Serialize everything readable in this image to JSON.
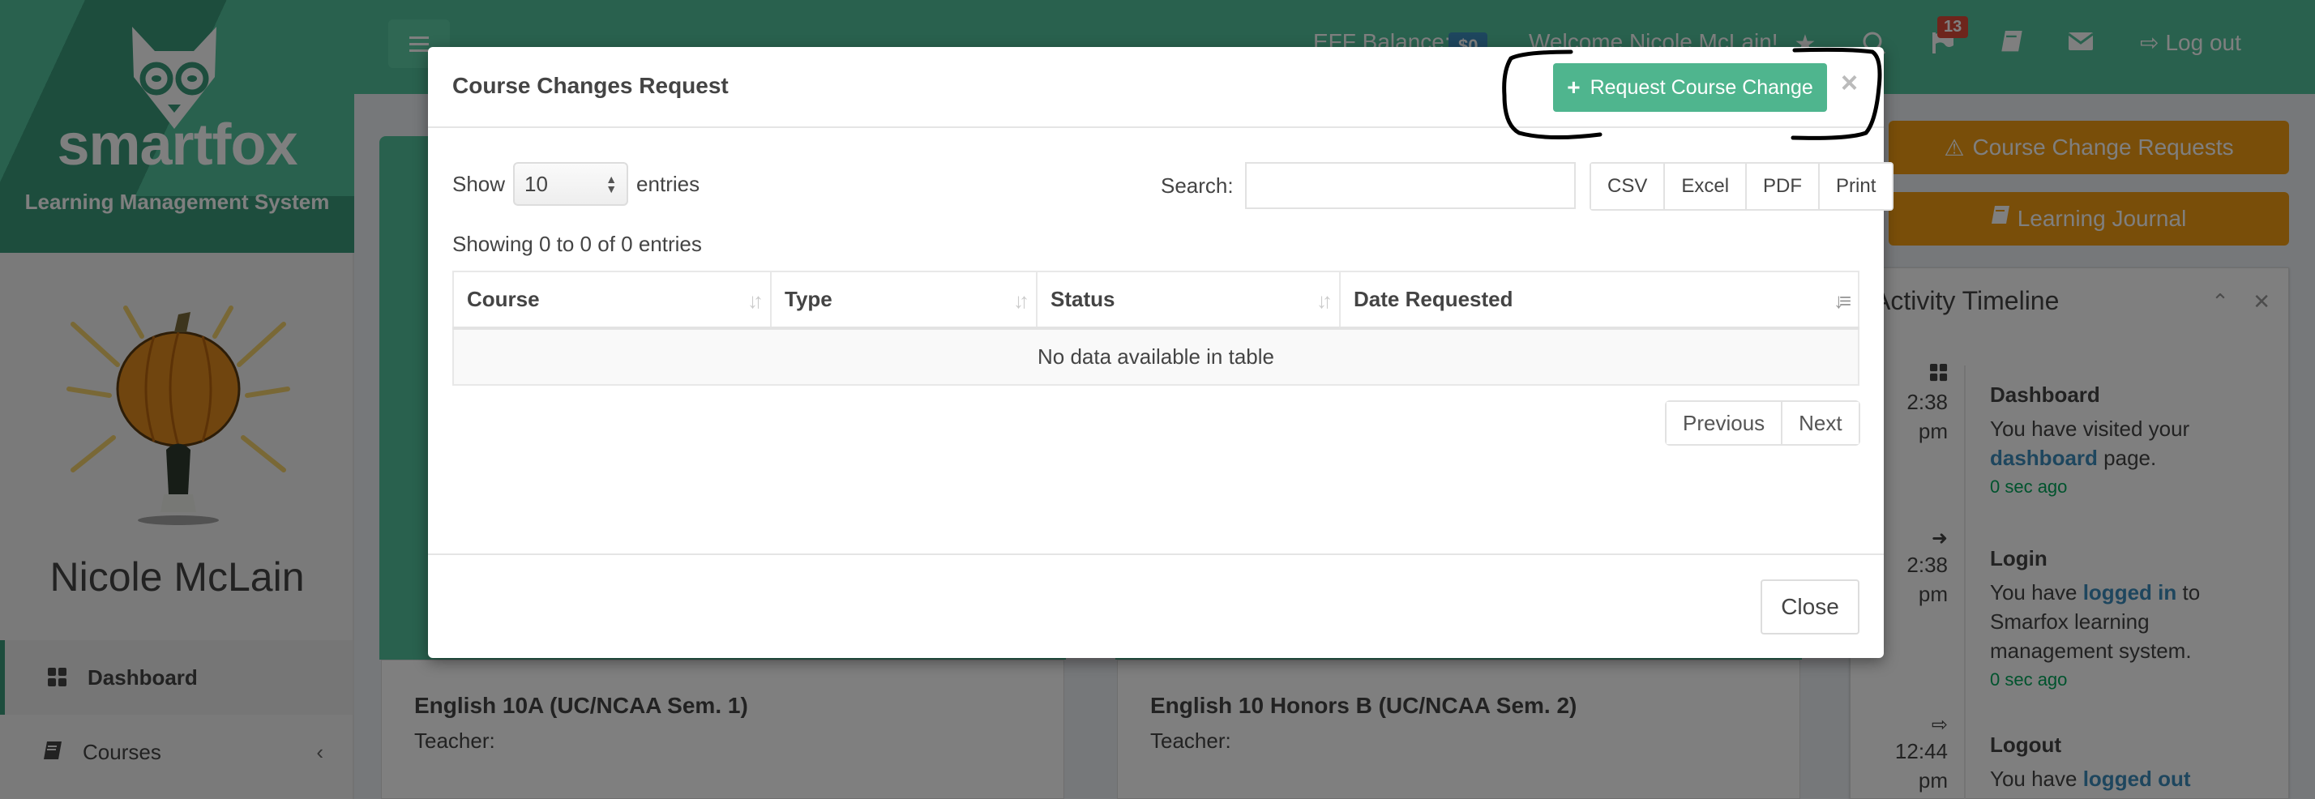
{
  "brand": {
    "name": "smartfox",
    "subtitle": "Learning Management System"
  },
  "user": {
    "name": "Nicole McLain"
  },
  "sidebar": {
    "items": [
      {
        "label": "Dashboard",
        "icon": "dashboard-icon",
        "active": true
      },
      {
        "label": "Courses",
        "icon": "book-icon",
        "active": false,
        "chevron": "‹"
      }
    ]
  },
  "topbar": {
    "menu_icon": "hamburger-icon",
    "eff_label": "EFF Balance:",
    "eff_value": "$0",
    "welcome": "Welcome Nicole McLain!",
    "icons": [
      "star-icon",
      "search-icon",
      "flag-icon",
      "book-icon",
      "envelope-icon"
    ],
    "notification_count": "13",
    "logout_label": "Log out"
  },
  "courses": [
    {
      "title": "English 10A (UC/NCAA Sem. 1)",
      "teacher": "Teacher:"
    },
    {
      "title": "English 10 Honors B (UC/NCAA Sem. 2)",
      "teacher": "Teacher:"
    }
  ],
  "right_panel": {
    "buttons": [
      {
        "label": "Course Change Requests",
        "icon": "warning-icon"
      },
      {
        "label": "Learning Journal",
        "icon": "book-icon"
      }
    ],
    "timeline": {
      "title": "Activity Timeline",
      "entries": [
        {
          "icon": "dashboard-icon",
          "time": "2:38",
          "ampm": "pm",
          "heading": "Dashboard",
          "pre": "You have visited your ",
          "link": "dashboard",
          "post": " page.",
          "ago": "0 sec ago"
        },
        {
          "icon": "sign-in-icon",
          "time": "2:38",
          "ampm": "pm",
          "heading": "Login",
          "pre": "You have ",
          "link": "logged in",
          "post": " to Smarfox learning management system.",
          "ago": "0 sec ago"
        },
        {
          "icon": "sign-out-icon",
          "time": "12:44",
          "ampm": "pm",
          "heading": "Logout",
          "pre": "You have ",
          "link": "logged out",
          "post": "",
          "ago": ""
        }
      ]
    }
  },
  "modal": {
    "title": "Course Changes Request",
    "request_button": "Request Course Change",
    "close_x": "×",
    "length": {
      "show": "Show",
      "value": "10",
      "entries": "entries"
    },
    "search": {
      "label": "Search:",
      "value": "",
      "placeholder": ""
    },
    "export_buttons": [
      "CSV",
      "Excel",
      "PDF",
      "Print"
    ],
    "info": "Showing 0 to 0 of 0 entries",
    "columns": [
      "Course",
      "Type",
      "Status",
      "Date Requested"
    ],
    "empty_message": "No data available in table",
    "paging": {
      "previous": "Previous",
      "next": "Next"
    },
    "close_button": "Close"
  },
  "colors": {
    "brand_green": "#53c29c",
    "primary_button": "#4fb58e",
    "warning": "#f39c12",
    "notification": "#dd4b39",
    "link": "#3c8dbc",
    "time_ago": "#00a65a"
  }
}
